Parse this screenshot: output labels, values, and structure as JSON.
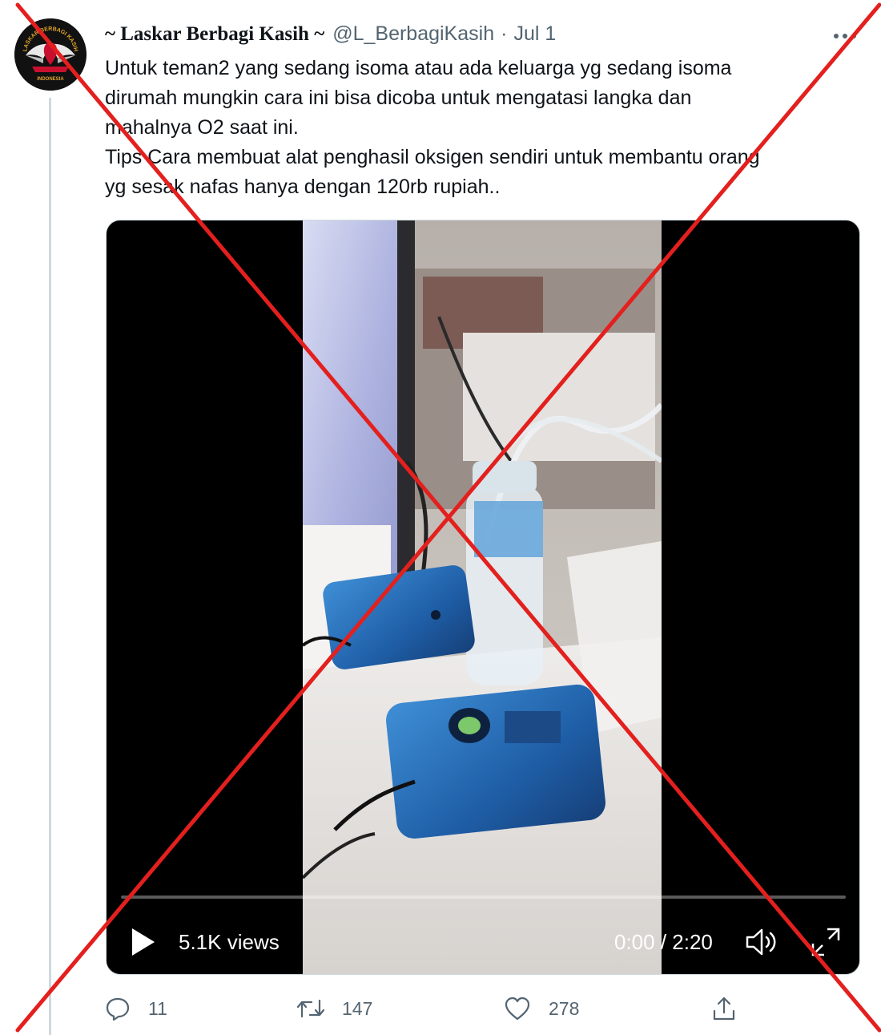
{
  "tweet": {
    "author": {
      "display_name": "~ Laskar Berbagi Kasih ~",
      "handle": "@L_BerbagiKasih",
      "avatar_text_top": "LASKAR BERBAGI KASIH",
      "avatar_text_bottom": "INDONESIA"
    },
    "separator": "·",
    "date": "Jul 1",
    "text_lines": [
      "Untuk teman2 yang sedang isoma atau ada keluarga yg sedang isoma",
      "dirumah mungkin cara ini bisa dicoba untuk mengatasi langka dan",
      "mahalnya O2 saat ini.",
      "Tips Cara membuat alat penghasil oksigen sendiri untuk membantu orang",
      "yg sesak nafas hanya dengan 120rb rupiah.."
    ]
  },
  "video": {
    "views": "5.1K views",
    "time": "0:00 / 2:20",
    "progress_fraction": 0,
    "icons": {
      "play": "play-icon",
      "volume": "volume-icon",
      "fullscreen": "fullscreen-icon"
    }
  },
  "actions": [
    {
      "name": "reply",
      "icon": "reply-icon",
      "count": "11"
    },
    {
      "name": "retweet",
      "icon": "retweet-icon",
      "count": "147"
    },
    {
      "name": "like",
      "icon": "heart-icon",
      "count": "278"
    },
    {
      "name": "share",
      "icon": "share-icon",
      "count": ""
    }
  ],
  "colors": {
    "cross": "#e3201e",
    "accent": "#1d9bf0",
    "secondary_text": "#536471"
  }
}
